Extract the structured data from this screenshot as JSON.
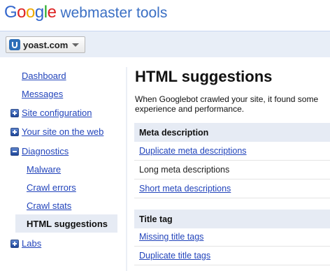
{
  "header": {
    "logo_letters": [
      "G",
      "o",
      "o",
      "g",
      "l",
      "e"
    ],
    "product": "webmaster tools"
  },
  "site_selector": {
    "value": "yoast.com",
    "icon": "site-favicon-icon"
  },
  "sidebar": {
    "items": [
      {
        "label": "Dashboard"
      },
      {
        "label": "Messages"
      },
      {
        "label": "Site configuration",
        "icon": "expand-plus-icon"
      },
      {
        "label": "Your site on the web",
        "icon": "expand-plus-icon"
      },
      {
        "label": "Diagnostics",
        "icon": "collapse-minus-icon"
      },
      {
        "label": "Malware"
      },
      {
        "label": "Crawl errors"
      },
      {
        "label": "Crawl stats"
      },
      {
        "label": "HTML suggestions",
        "active": true
      },
      {
        "label": "Labs",
        "icon": "expand-plus-icon"
      }
    ]
  },
  "main": {
    "title": "HTML suggestions",
    "intro_line1": "When Googlebot crawled your site, it found some",
    "intro_line2": "experience and performance.",
    "sections": [
      {
        "heading": "Meta description",
        "rows": [
          {
            "label": "Duplicate meta descriptions",
            "link": true
          },
          {
            "label": "Long meta descriptions",
            "link": false
          },
          {
            "label": "Short meta descriptions",
            "link": true
          }
        ]
      },
      {
        "heading": "Title tag",
        "rows": [
          {
            "label": "Missing title tags",
            "link": true
          },
          {
            "label": "Duplicate title tags",
            "link": true
          }
        ]
      }
    ]
  },
  "colors": {
    "link": "#2244bb",
    "header_bar": "#e8eef7",
    "section_bg": "#e6ebf4",
    "google_blue": "#3366cc",
    "google_red": "#dd2222",
    "google_yellow": "#eeaa00",
    "google_green": "#22aa22"
  }
}
